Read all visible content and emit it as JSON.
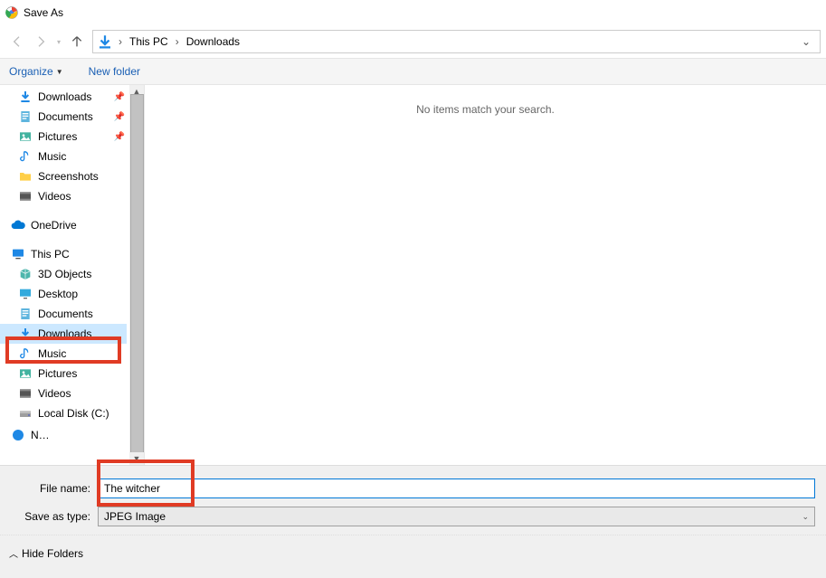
{
  "title": "Save As",
  "breadcrumb": {
    "parent": "This PC",
    "current": "Downloads"
  },
  "toolbar": {
    "organize": "Organize",
    "newfolder": "New folder"
  },
  "tree": {
    "quick": [
      {
        "label": "Downloads",
        "icon": "download"
      },
      {
        "label": "Documents",
        "icon": "doc"
      },
      {
        "label": "Pictures",
        "icon": "pictures"
      },
      {
        "label": "Music",
        "icon": "music"
      },
      {
        "label": "Screenshots",
        "icon": "folder"
      },
      {
        "label": "Videos",
        "icon": "video"
      }
    ],
    "onedrive": "OneDrive",
    "thispc": "This PC",
    "pcitems": [
      {
        "label": "3D Objects",
        "icon": "cube"
      },
      {
        "label": "Desktop",
        "icon": "desktop"
      },
      {
        "label": "Documents",
        "icon": "doc"
      },
      {
        "label": "Downloads",
        "icon": "download",
        "selected": true
      },
      {
        "label": "Music",
        "icon": "music"
      },
      {
        "label": "Pictures",
        "icon": "pictures"
      },
      {
        "label": "Videos",
        "icon": "video"
      },
      {
        "label": "Local Disk (C:)",
        "icon": "disk"
      }
    ]
  },
  "content_empty": "No items match your search.",
  "fields": {
    "filename_label": "File name:",
    "filename_value": "The witcher",
    "type_label": "Save as type:",
    "type_value": "JPEG Image"
  },
  "footer": {
    "hide": "Hide Folders"
  }
}
